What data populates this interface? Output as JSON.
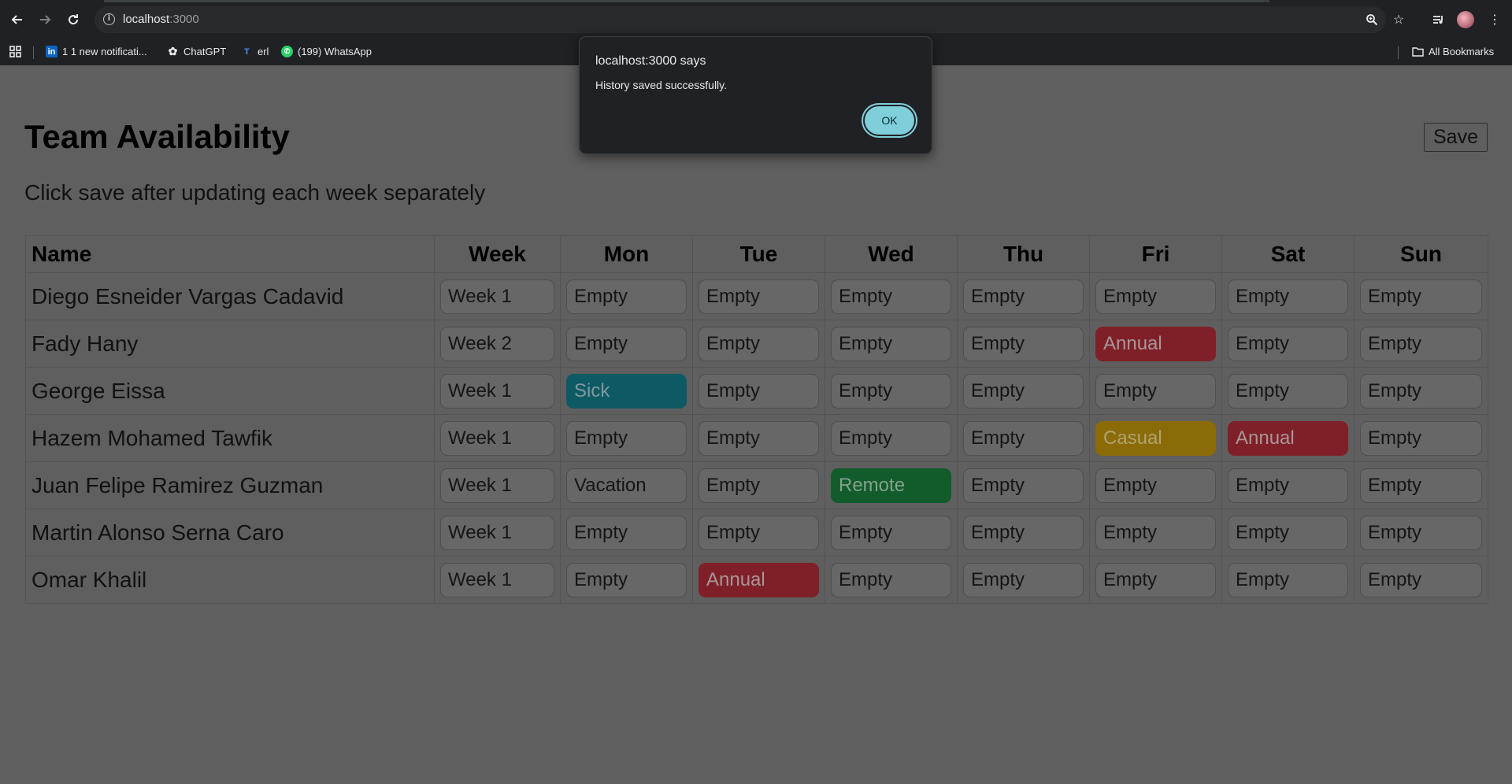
{
  "browser": {
    "url_host": "localhost",
    "url_port": ":3000",
    "bookmarks": [
      {
        "label": "1 1 new notificati...",
        "icon": "linkedin-icon"
      },
      {
        "label": "ChatGPT",
        "icon": "chatgpt-icon"
      },
      {
        "label": "erl",
        "icon": "t-icon"
      },
      {
        "label": "(199) WhatsApp",
        "icon": "whatsapp-icon"
      }
    ],
    "all_bookmarks": "All Bookmarks"
  },
  "page": {
    "title": "Team Availability",
    "save_label": "Save",
    "subtitle": "Click save after updating each week separately"
  },
  "table": {
    "headers": [
      "Name",
      "Week",
      "Mon",
      "Tue",
      "Wed",
      "Thu",
      "Fri",
      "Sat",
      "Sun"
    ],
    "rows": [
      {
        "name": "Diego Esneider Vargas Cadavid",
        "week": "Week 1",
        "days": [
          "Empty",
          "Empty",
          "Empty",
          "Empty",
          "Empty",
          "Empty",
          "Empty"
        ]
      },
      {
        "name": "Fady Hany",
        "week": "Week 2",
        "days": [
          "Empty",
          "Empty",
          "Empty",
          "Empty",
          "Annual",
          "Empty",
          "Empty"
        ]
      },
      {
        "name": "George Eissa",
        "week": "Week 1",
        "days": [
          "Sick",
          "Empty",
          "Empty",
          "Empty",
          "Empty",
          "Empty",
          "Empty"
        ]
      },
      {
        "name": "Hazem Mohamed Tawfik",
        "week": "Week 1",
        "days": [
          "Empty",
          "Empty",
          "Empty",
          "Empty",
          "Casual",
          "Annual",
          "Empty"
        ]
      },
      {
        "name": "Juan Felipe Ramirez Guzman",
        "week": "Week 1",
        "days": [
          "Vacation",
          "Empty",
          "Remote",
          "Empty",
          "Empty",
          "Empty",
          "Empty"
        ]
      },
      {
        "name": "Martin Alonso Serna Caro",
        "week": "Week 1",
        "days": [
          "Empty",
          "Empty",
          "Empty",
          "Empty",
          "Empty",
          "Empty",
          "Empty"
        ]
      },
      {
        "name": "Omar Khalil",
        "week": "Week 1",
        "days": [
          "Empty",
          "Annual",
          "Empty",
          "Empty",
          "Empty",
          "Empty",
          "Empty"
        ]
      }
    ]
  },
  "status_colors": {
    "Annual": "#7f2028",
    "Sick": "#0d5a65",
    "Casual": "#8a6b07",
    "Remote": "#125c2c",
    "Empty": "#676767",
    "Vacation": "#676767"
  },
  "dialog": {
    "title": "localhost:3000 says",
    "message": "History saved successfully.",
    "ok_label": "OK"
  }
}
